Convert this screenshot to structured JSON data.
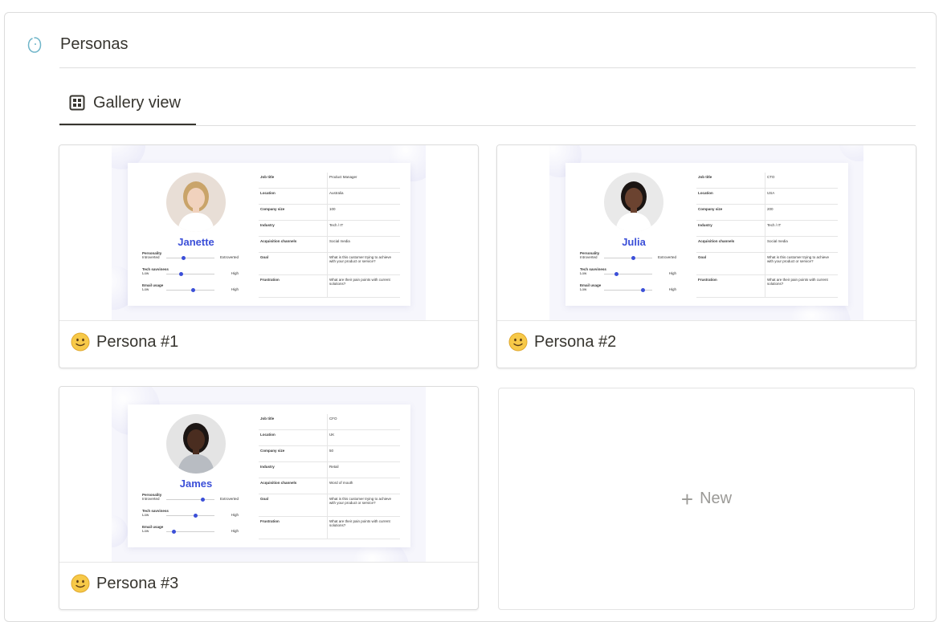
{
  "database": {
    "title": "Personas",
    "icon": "page-icon"
  },
  "view_tab": {
    "label": "Gallery view",
    "icon": "gallery-grid-icon"
  },
  "colors": {
    "accent": "#3b4fd8",
    "text": "#37352f",
    "muted": "#9b9a97",
    "border": "#dcdcdc"
  },
  "trait_labels": {
    "personality": "Personality",
    "introverted": "Introverted",
    "extroverted": "Extroverted",
    "tech": "Tech savviness",
    "email": "Email usage",
    "low": "Low",
    "high": "High"
  },
  "field_labels": {
    "job": "Job title",
    "location": "Location",
    "company": "Company size",
    "industry": "Industry",
    "acquisition": "Acquisition channels",
    "goal": "Goal",
    "frustration": "Frustration"
  },
  "cards": [
    {
      "title": "Persona #1",
      "emoji": "slightly-smiling-face",
      "cover": {
        "name": "Janette",
        "fields": {
          "job": "Product Manager",
          "location": "Australia",
          "company": "100",
          "industry": "Tech / IT",
          "acquisition": "Social media",
          "goal": "What is this customer trying to achieve with your product or service?",
          "frustration": "What are their pain points with current solutions?"
        },
        "levels": {
          "personality": 0.35,
          "tech": 0.3,
          "email": 0.55
        }
      }
    },
    {
      "title": "Persona #2",
      "emoji": "slightly-smiling-face",
      "cover": {
        "name": "Julia",
        "fields": {
          "job": "CTO",
          "location": "USA",
          "company": "200",
          "industry": "Tech / IT",
          "acquisition": "Social media",
          "goal": "What is this customer trying to achieve with your product or service?",
          "frustration": "What are their pain points with current solutions?"
        },
        "levels": {
          "personality": 0.6,
          "tech": 0.25,
          "email": 0.8
        }
      }
    },
    {
      "title": "Persona #3",
      "emoji": "slightly-smiling-face",
      "cover": {
        "name": "James",
        "fields": {
          "job": "CFO",
          "location": "UK",
          "company": "50",
          "industry": "Retail",
          "acquisition": "Word of mouth",
          "goal": "What is this customer trying to achieve with your product or service?",
          "frustration": "What are their pain points with current solutions?"
        },
        "levels": {
          "personality": 0.75,
          "tech": 0.6,
          "email": 0.15
        }
      }
    }
  ],
  "new_card": {
    "label": "New",
    "icon": "plus-icon"
  }
}
